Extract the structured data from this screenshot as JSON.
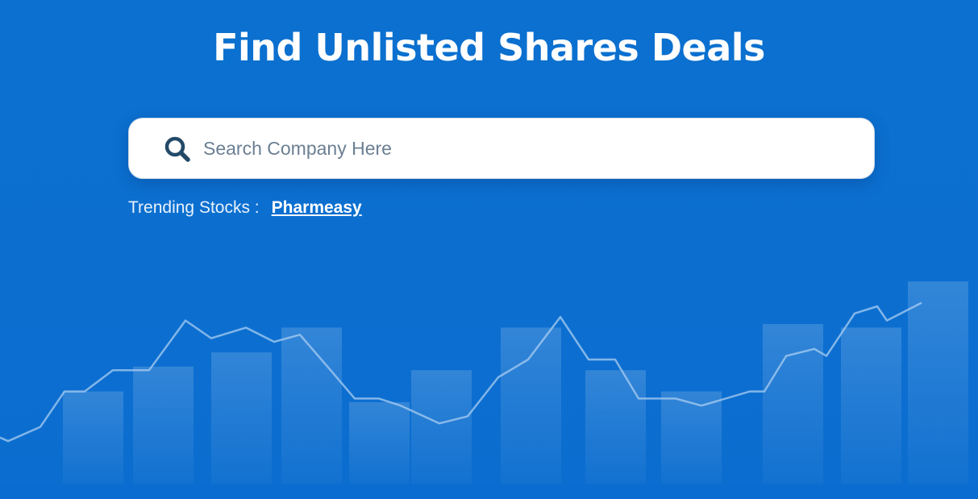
{
  "hero": {
    "title": "Find Unlisted Shares Deals"
  },
  "search": {
    "placeholder": "Search Company Here",
    "value": ""
  },
  "trending": {
    "label": "Trending Stocks :",
    "items": [
      "Pharmeasy"
    ]
  },
  "icons": {
    "search": "search-icon"
  },
  "colors": {
    "background": "#0b70cf",
    "search_icon": "#234a68",
    "placeholder": "#6b7f93",
    "title": "#ffffff"
  },
  "chart_data": {
    "type": "bar",
    "decorative": true,
    "bar_levels": [
      0.26,
      0.33,
      0.37,
      0.44,
      0.23,
      0.32,
      0.44,
      0.32,
      0.26,
      0.45,
      0.44,
      0.57
    ],
    "line_levels": [
      0.13,
      0.12,
      0.16,
      0.26,
      0.26,
      0.32,
      0.32,
      0.46,
      0.41,
      0.44,
      0.4,
      0.42,
      0.32,
      0.24,
      0.24,
      0.22,
      0.17,
      0.19,
      0.3,
      0.35,
      0.47,
      0.35,
      0.35,
      0.24,
      0.24,
      0.22,
      0.26,
      0.26,
      0.36,
      0.38,
      0.36,
      0.48,
      0.5,
      0.46,
      0.51
    ]
  }
}
